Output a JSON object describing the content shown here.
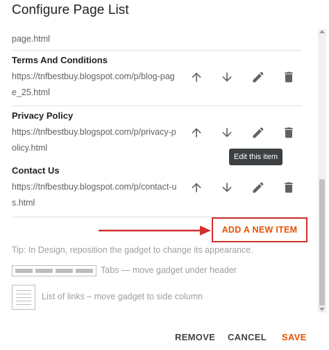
{
  "dialog": {
    "title": "Configure Page List"
  },
  "list": {
    "partial_url": "page.html",
    "items": [
      {
        "title": "Terms And Conditions",
        "url": "https://tnfbestbuy.blogspot.com/p/blog-page_25.html"
      },
      {
        "title": "Privacy Policy",
        "url": "https://tnfbestbuy.blogspot.com/p/privacy-policy.html"
      },
      {
        "title": "Contact Us",
        "url": "https://tnfbestbuy.blogspot.com/p/contact-us.html"
      }
    ],
    "action_icons": [
      "arrow-up-icon",
      "arrow-down-icon",
      "pencil-icon",
      "trash-icon"
    ]
  },
  "tooltip": {
    "text": "Edit this item"
  },
  "add_item": {
    "label": "ADD A NEW ITEM"
  },
  "tip": {
    "text": "Tip: In Design, reposition the gadget to change its appearance.",
    "tabs_label": "Tabs — move gadget under header",
    "links_label": "List of links – move gadget to side column"
  },
  "footer": {
    "remove": "REMOVE",
    "cancel": "CANCEL",
    "save": "SAVE"
  },
  "colors": {
    "accent": "#e65100",
    "highlight": "#d32f2f",
    "tooltip_bg": "#3c4043",
    "text": "#212121",
    "muted": "#616161"
  }
}
